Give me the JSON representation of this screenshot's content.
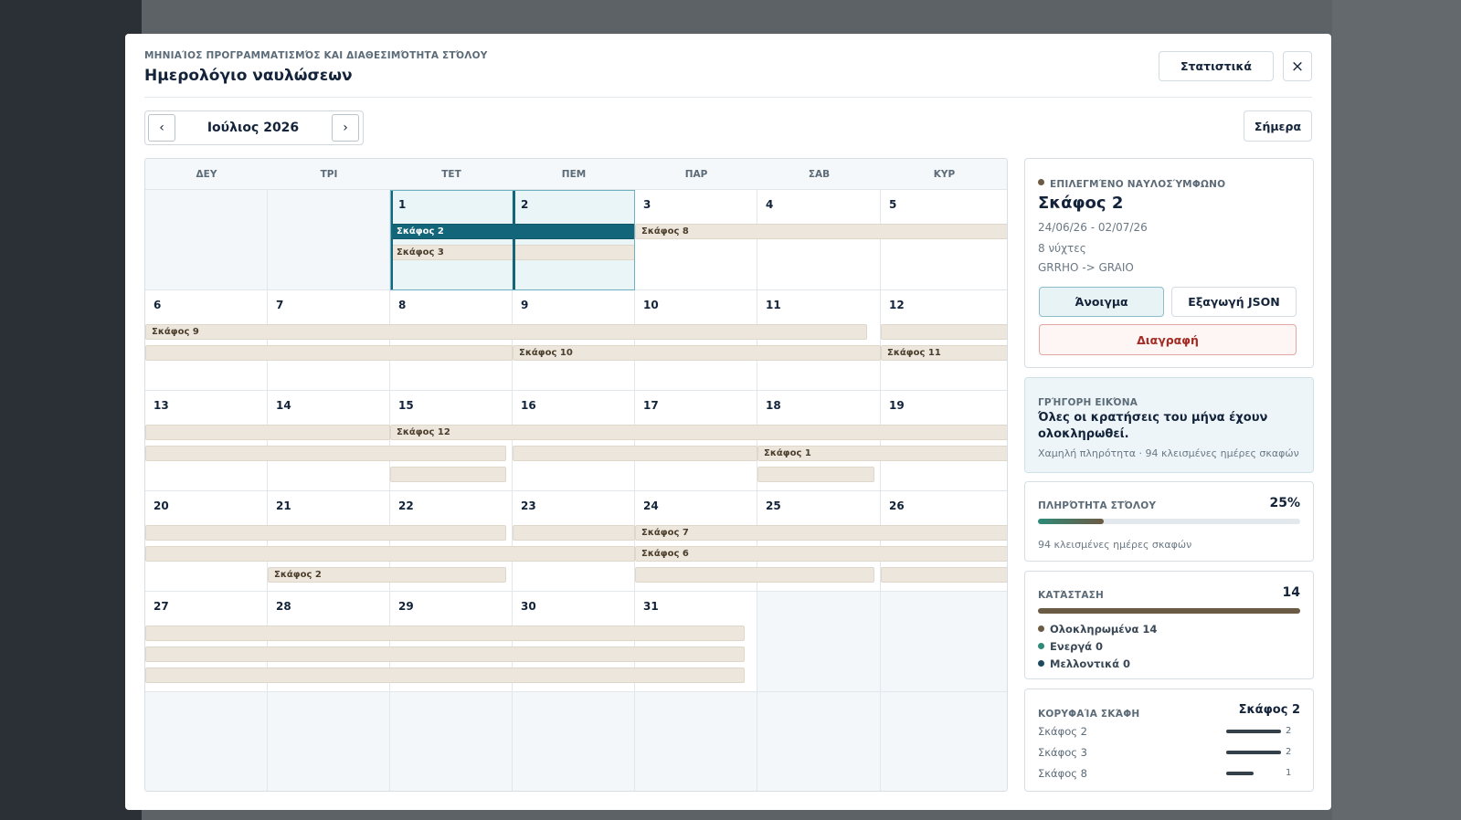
{
  "header": {
    "eyebrow": "ΜΗΝΙΑΊΟΣ ΠΡΟΓΡΑΜΜΑΤΙΣΜΌΣ ΚΑΙ ΔΙΑΘΕΣΙΜΌΤΗΤΑ ΣΤΌΛΟΥ",
    "title": "Ημερολόγιο ναυλώσεων",
    "stats_button": "Στατιστικά",
    "close_icon": "×"
  },
  "nav": {
    "month_label": "Ιούλιος 2026",
    "prev_icon": "‹",
    "next_icon": "›",
    "today_button": "Σήμερα"
  },
  "calendar": {
    "weekdays": [
      "ΔΕΥ",
      "ΤΡΙ",
      "ΤΕΤ",
      "ΠΕΜ",
      "ΠΑΡ",
      "ΣΑΒ",
      "ΚΥΡ"
    ],
    "weeks": [
      [
        "",
        "",
        "1",
        "2",
        "3",
        "4",
        "5"
      ],
      [
        "6",
        "7",
        "8",
        "9",
        "10",
        "11",
        "12"
      ],
      [
        "13",
        "14",
        "15",
        "16",
        "17",
        "18",
        "19"
      ],
      [
        "20",
        "21",
        "22",
        "23",
        "24",
        "25",
        "26"
      ],
      [
        "27",
        "28",
        "29",
        "30",
        "31",
        "",
        ""
      ]
    ],
    "selected_days": [
      "1",
      "2"
    ],
    "event_labels": {
      "e1": "Σκάφος 2",
      "e2": "Σκάφος 3",
      "e3": "Σκάφος 8",
      "e4": "Σκάφος 9",
      "e5": "Σκάφος 10",
      "e6": "Σκάφος 11",
      "e7": "Σκάφος 12",
      "e8": "Σκάφος 1",
      "e9": "Σκάφος 7",
      "e10": "Σκάφος 6",
      "e11": "Σκάφος 2"
    }
  },
  "selected_charter": {
    "title": "ΕΠΙΛΕΓΜΈΝΟ ΝΑΥΛΟΣΎΜΦΩΝΟ",
    "vessel": "Σκάφος 2",
    "dates": "24/06/26 - 02/07/26",
    "nights": "8 νύχτες",
    "route": "GRRHO -> GRAIO",
    "open_button": "Άνοιγμα",
    "export_button": "Εξαγωγή JSON",
    "delete_button": "Διαγραφή",
    "status_color": "#6b5a44"
  },
  "quick_view": {
    "title": "ΓΡΉΓΟΡΗ ΕΙΚΌΝΑ",
    "headline": "Όλες οι κρατήσεις του μήνα έχουν ολοκληρωθεί.",
    "subtitle": "Χαμηλή πληρότητα · 94 κλεισμένες ημέρες σκαφών"
  },
  "occupancy": {
    "title": "ΠΛΗΡΌΤΗΤΑ ΣΤΌΛΟΥ",
    "value_text": "25%",
    "value": 0.25,
    "caption": "94 κλεισμένες ημέρες σκαφών"
  },
  "status": {
    "title": "ΚΑΤΆΣΤΑΣΗ",
    "total": "14",
    "items": [
      {
        "label": "Ολοκληρωμένα 14",
        "color": "#6b5a44"
      },
      {
        "label": "Ενεργά 0",
        "color": "#2f8a78"
      },
      {
        "label": "Μελλοντικά 0",
        "color": "#1d4a5e"
      }
    ]
  },
  "top_vessels": {
    "title": "ΚΟΡΥΦΑΊΑ ΣΚΆΦΗ",
    "top": "Σκάφος 2",
    "items": [
      {
        "name": "Σκάφος 2",
        "value": "2"
      },
      {
        "name": "Σκάφος 3",
        "value": "2"
      },
      {
        "name": "Σκάφος 8",
        "value": "1"
      }
    ]
  }
}
